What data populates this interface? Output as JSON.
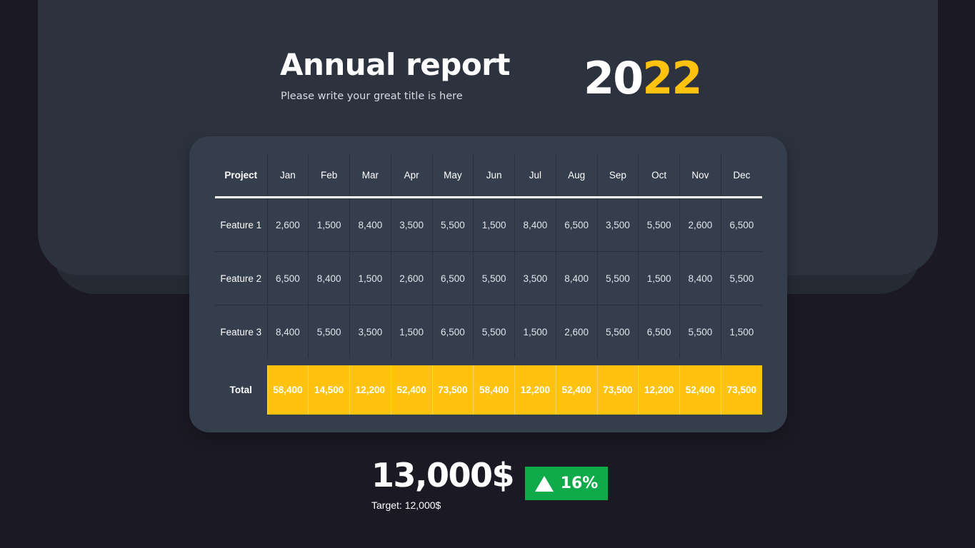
{
  "header": {
    "title": "Annual report",
    "subtitle": "Please write your great title is here",
    "year_part1": "20",
    "year_part2": "22"
  },
  "table": {
    "corner_label": "Project",
    "months": [
      "Jan",
      "Feb",
      "Mar",
      "Apr",
      "May",
      "Jun",
      "Jul",
      "Aug",
      "Sep",
      "Oct",
      "Nov",
      "Dec"
    ],
    "rows": [
      {
        "label": "Feature 1",
        "values": [
          "2,600",
          "1,500",
          "8,400",
          "3,500",
          "5,500",
          "1,500",
          "8,400",
          "6,500",
          "3,500",
          "5,500",
          "2,600",
          "6,500"
        ]
      },
      {
        "label": "Feature 2",
        "values": [
          "6,500",
          "8,400",
          "1,500",
          "2,600",
          "6,500",
          "5,500",
          "3,500",
          "8,400",
          "5,500",
          "1,500",
          "8,400",
          "5,500"
        ]
      },
      {
        "label": "Feature 3",
        "values": [
          "8,400",
          "5,500",
          "3,500",
          "1,500",
          "6,500",
          "5,500",
          "1,500",
          "2,600",
          "5,500",
          "6,500",
          "5,500",
          "1,500"
        ]
      }
    ],
    "total": {
      "label": "Total",
      "values": [
        "58,400",
        "14,500",
        "12,200",
        "52,400",
        "73,500",
        "58,400",
        "12,200",
        "52,400",
        "73,500",
        "12,200",
        "52,400",
        "73,500"
      ]
    }
  },
  "summary": {
    "amount": "13,000$",
    "target": "Target: 12,000$",
    "change": "16%",
    "change_icon": "triangle-up-icon",
    "change_color": "#0fab4b"
  },
  "colors": {
    "accent": "#ffc20e",
    "background": "#1b1a24",
    "panel": "#2c323e",
    "card": "#353e4d"
  }
}
